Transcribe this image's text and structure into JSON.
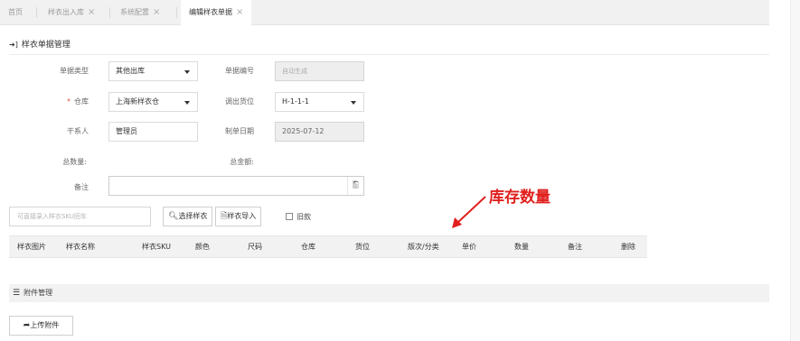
{
  "tabs": [
    {
      "label": "首页",
      "closable": false,
      "active": false
    },
    {
      "label": "样衣出入库",
      "closable": true,
      "active": false
    },
    {
      "label": "系统配置",
      "closable": true,
      "active": false
    },
    {
      "label": "编辑样衣单据",
      "closable": true,
      "active": true
    }
  ],
  "close_glyph": "×",
  "section": {
    "title": "样衣单据管理",
    "icon": "sign-in-icon"
  },
  "form": {
    "doc_type": {
      "label": "单据类型",
      "value": "其他出库"
    },
    "doc_no": {
      "label": "单据编号",
      "placeholder": "自动生成"
    },
    "warehouse": {
      "label": "仓库",
      "required_mark": "*",
      "value": "上海新样衣仓"
    },
    "out_location": {
      "label": "调出货位",
      "value": "H-1-1-1"
    },
    "contact": {
      "label": "干系人",
      "value": "管理员"
    },
    "create_date": {
      "label": "制单日期",
      "value": "2025-07-12"
    },
    "total_qty": {
      "label": "总数量:"
    },
    "total_amount": {
      "label": "总金额:"
    },
    "remark": {
      "label": "备注",
      "value": ""
    }
  },
  "annotation": {
    "text": "库存数量",
    "color": "#e0201e"
  },
  "toolbar": {
    "sku_placeholder": "可直接录入样衣SKU回车",
    "select_sample_label": "选择样衣",
    "import_sample_label": "样衣导入",
    "old_style_label": "旧款"
  },
  "table": {
    "columns": [
      "样衣图片",
      "样衣名称",
      "样衣SKU",
      "颜色",
      "尺码",
      "仓库",
      "货位",
      "版次/分类",
      "单价",
      "数量",
      "备注",
      "删除"
    ]
  },
  "attachments": {
    "title": "附件管理",
    "upload_label": "上传附件"
  }
}
